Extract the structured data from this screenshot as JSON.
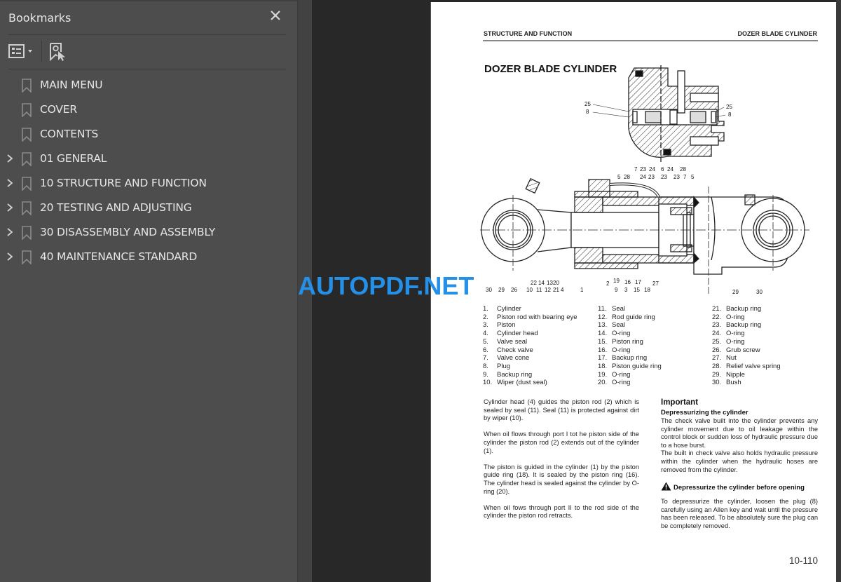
{
  "sidebar": {
    "title": "Bookmarks",
    "close_icon": "close-icon",
    "toolbar": {
      "options_icon": "list-options-icon",
      "find_icon": "find-current-bookmark-icon"
    },
    "items": [
      {
        "label": "MAIN MENU",
        "expandable": false
      },
      {
        "label": "COVER",
        "expandable": false
      },
      {
        "label": "CONTENTS",
        "expandable": false
      },
      {
        "label": "01 GENERAL",
        "expandable": true
      },
      {
        "label": "10 STRUCTURE AND FUNCTION",
        "expandable": true
      },
      {
        "label": "20 TESTING AND ADJUSTING",
        "expandable": true
      },
      {
        "label": "30 DISASSEMBLY AND ASSEMBLY",
        "expandable": true
      },
      {
        "label": "40 MAINTENANCE STANDARD",
        "expandable": true
      }
    ]
  },
  "watermark": "AUTOPDF.NET",
  "page": {
    "header_left": "STRUCTURE AND FUNCTION",
    "header_right": "DOZER BLADE CYLINDER",
    "title": "DOZER BLADE CYLINDER",
    "diagram": {
      "valve_labels_top": [
        "25",
        "8",
        "25",
        "8"
      ],
      "valve_labels_bottom": [
        "5",
        "28",
        "7",
        "23",
        "24",
        "6",
        "24",
        "28",
        "5",
        "24",
        "23",
        "23",
        "23",
        "7"
      ],
      "cylinder_labels": [
        "30",
        "29",
        "26",
        "10",
        "22",
        "11",
        "14",
        "12",
        "13",
        "21",
        "20",
        "4",
        "1",
        "2",
        "19",
        "9",
        "3",
        "16",
        "15",
        "17",
        "18",
        "27",
        "29",
        "30"
      ]
    },
    "parts": [
      {
        "n": "1.",
        "name": "Cylinder"
      },
      {
        "n": "2.",
        "name": "Piston rod with bearing eye"
      },
      {
        "n": "3.",
        "name": "Piston"
      },
      {
        "n": "4.",
        "name": "Cylinder head"
      },
      {
        "n": "5.",
        "name": "Valve seal"
      },
      {
        "n": "6.",
        "name": "Check valve"
      },
      {
        "n": "7.",
        "name": "Valve cone"
      },
      {
        "n": "8.",
        "name": "Plug"
      },
      {
        "n": "9.",
        "name": "Backup ring"
      },
      {
        "n": "10.",
        "name": "Wiper (dust seal)"
      },
      {
        "n": "11.",
        "name": "Seal"
      },
      {
        "n": "12.",
        "name": "Rod guide ring"
      },
      {
        "n": "13.",
        "name": "Seal"
      },
      {
        "n": "14.",
        "name": "O-ring"
      },
      {
        "n": "15.",
        "name": "Piston ring"
      },
      {
        "n": "16.",
        "name": "O-ring"
      },
      {
        "n": "17.",
        "name": "Backup ring"
      },
      {
        "n": "18.",
        "name": "Piston guide ring"
      },
      {
        "n": "19.",
        "name": "O-ring"
      },
      {
        "n": "20.",
        "name": "O-ring"
      },
      {
        "n": "21.",
        "name": "Backup ring"
      },
      {
        "n": "22.",
        "name": "O-ring"
      },
      {
        "n": "23.",
        "name": "Backup ring"
      },
      {
        "n": "24.",
        "name": "O-ring"
      },
      {
        "n": "25.",
        "name": "O-ring"
      },
      {
        "n": "26.",
        "name": "Grub screw"
      },
      {
        "n": "27.",
        "name": "Nut"
      },
      {
        "n": "28.",
        "name": "Relief valve spring"
      },
      {
        "n": "29.",
        "name": "Nipple"
      },
      {
        "n": "30.",
        "name": "Bush"
      }
    ],
    "left_paragraphs": [
      "Cylinder head (4) guides the piston rod (2) which is sealed by seal (11). Seal (11) is protected against dirt by wiper (10).",
      "When oil flows through port I tot he piston side of the cylinder the piston rod (2) extends out of the cylinder (1).",
      "The piston is guided in the cylinder (1) by the piston guide ring (18). It is sealed by the piston ring (16). The cylinder head is sealed against the cylinder by O-ring (20).",
      "When oil fows through port II to the rod side of the cylinder the piston rod retracts."
    ],
    "important": {
      "title": "Important",
      "subtitle": "Depressurizing the cylinder",
      "paragraphs": [
        "The check valve built into the cylinder prevents any cylinder movement due to oil leakage within the control block or sudden loss of hydraulic pressure due to a hose burst.",
        "The built in check valve also holds hydraulic pressure within the cylinder when the hydraulic hoses are removed from the cylinder."
      ],
      "warning": "Depressurize the cylinder before opening",
      "warning_icon": "warning-triangle-icon",
      "after_warning": "To depressurize the cylinder, loosen the plug (8) carefully using an Allen key and wait until the pressure has been released. To be absolutely sure the plug can be completely removed."
    },
    "page_number": "10-110"
  }
}
